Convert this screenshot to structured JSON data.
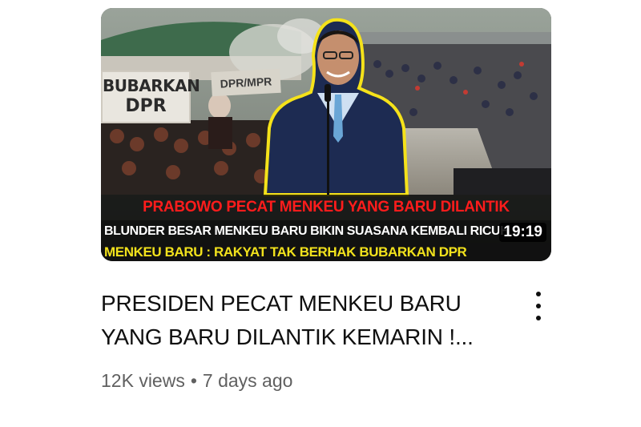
{
  "video": {
    "thumbnail": {
      "headline_red": "PRABOWO PECAT MENKEU YANG BARU DILANTIK",
      "headline_white": "BLUNDER BESAR MENKEU BARU BIKIN SUASANA KEMBALI RICUH",
      "headline_yellow": "MENKEU BARU : RAKYAT TAK BERHAK BUBARKAN DPR",
      "sign_line1": "BUBARKAN",
      "sign_line2": "DPR",
      "sign_small": "DPR/MPR"
    },
    "duration": "19:19",
    "title_line1": "PRESIDEN PECAT MENKEU BARU",
    "title_line2": "YANG BARU DILANTIK KEMARIN !...",
    "views": "12K views",
    "separator": "•",
    "age": "7 days ago",
    "more_icon": "three-dots-vertical-icon"
  }
}
